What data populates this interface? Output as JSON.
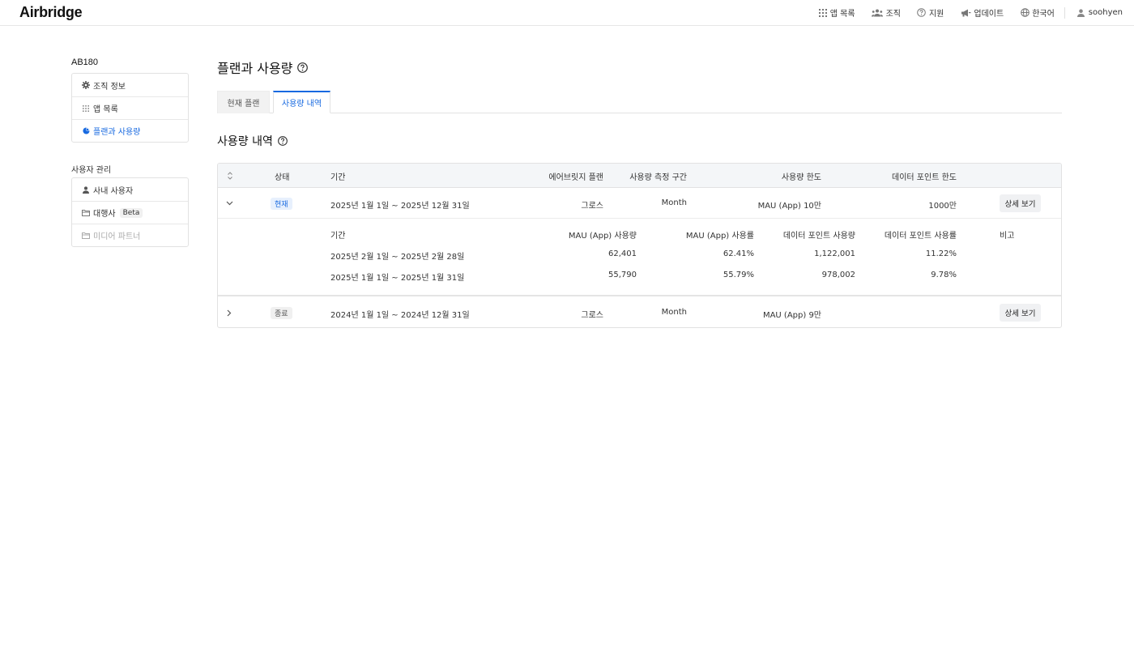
{
  "header": {
    "logo": "Airbridge",
    "nav": [
      {
        "label": "앱 목록",
        "icon": "grid-icon"
      },
      {
        "label": "조직",
        "icon": "people-icon"
      },
      {
        "label": "지원",
        "icon": "help-circle-icon"
      },
      {
        "label": "업데이트",
        "icon": "megaphone-icon"
      },
      {
        "label": "한국어",
        "icon": "globe-icon"
      }
    ],
    "user": {
      "label": "soohyen",
      "icon": "user-icon"
    }
  },
  "sidebar": {
    "org_name": "AB180",
    "org_items": [
      {
        "label": "조직 정보",
        "icon": "gear-icon"
      },
      {
        "label": "앱 목록",
        "icon": "grid-icon"
      },
      {
        "label": "플랜과 사용량",
        "icon": "pie-chart-icon",
        "active": true
      }
    ],
    "user_section_title": "사용자 관리",
    "user_items": [
      {
        "label": "사내 사용자",
        "icon": "user-icon"
      },
      {
        "label": "대행사",
        "icon": "folder-icon",
        "badge": "Beta"
      },
      {
        "label": "미디어 파트너",
        "icon": "folder-icon",
        "disabled": true
      }
    ]
  },
  "main": {
    "title": "플랜과 사용량",
    "tabs": [
      {
        "label": "현재 플랜"
      },
      {
        "label": "사용량 내역",
        "active": true
      }
    ],
    "section_title": "사용량 내역",
    "table": {
      "headers": {
        "status": "상태",
        "period": "기간",
        "plan": "에어브릿지 플랜",
        "interval": "사용량 측정 구간",
        "limit": "사용량 한도",
        "dp_limit": "데이터 포인트 한도"
      },
      "rows": [
        {
          "status": "현재",
          "period": "2025년 1월 1일 ~ 2025년 12월 31일",
          "plan": "그로스",
          "interval": "Month",
          "limit": "MAU (App) 10만",
          "dp_limit": "1000만",
          "action": "상세 보기",
          "expanded": true
        },
        {
          "status": "종료",
          "period": "2024년 1월 1일 ~ 2024년 12월 31일",
          "plan": "그로스",
          "interval": "Month",
          "limit": "MAU (App) 9만",
          "dp_limit": "",
          "action": "상세 보기",
          "expanded": false
        }
      ],
      "detail": {
        "headers": {
          "period": "기간",
          "mau_usage": "MAU (App) 사용량",
          "mau_rate": "MAU (App) 사용률",
          "dp_usage": "데이터 포인트 사용량",
          "dp_rate": "데이터 포인트 사용률",
          "note": "비고"
        },
        "rows": [
          {
            "period": "2025년 2월 1일 ~ 2025년 2월 28일",
            "mau_usage": "62,401",
            "mau_rate": "62.41%",
            "dp_usage": "1,122,001",
            "dp_rate": "11.22%",
            "note": ""
          },
          {
            "period": "2025년 1월 1일 ~ 2025년 1월 31일",
            "mau_usage": "55,790",
            "mau_rate": "55.79%",
            "dp_usage": "978,002",
            "dp_rate": "9.78%",
            "note": ""
          }
        ]
      }
    }
  },
  "colors": {
    "accent": "#1769e0",
    "header_bg": "#f4f6f8",
    "button_bg": "#f0f1f3"
  }
}
